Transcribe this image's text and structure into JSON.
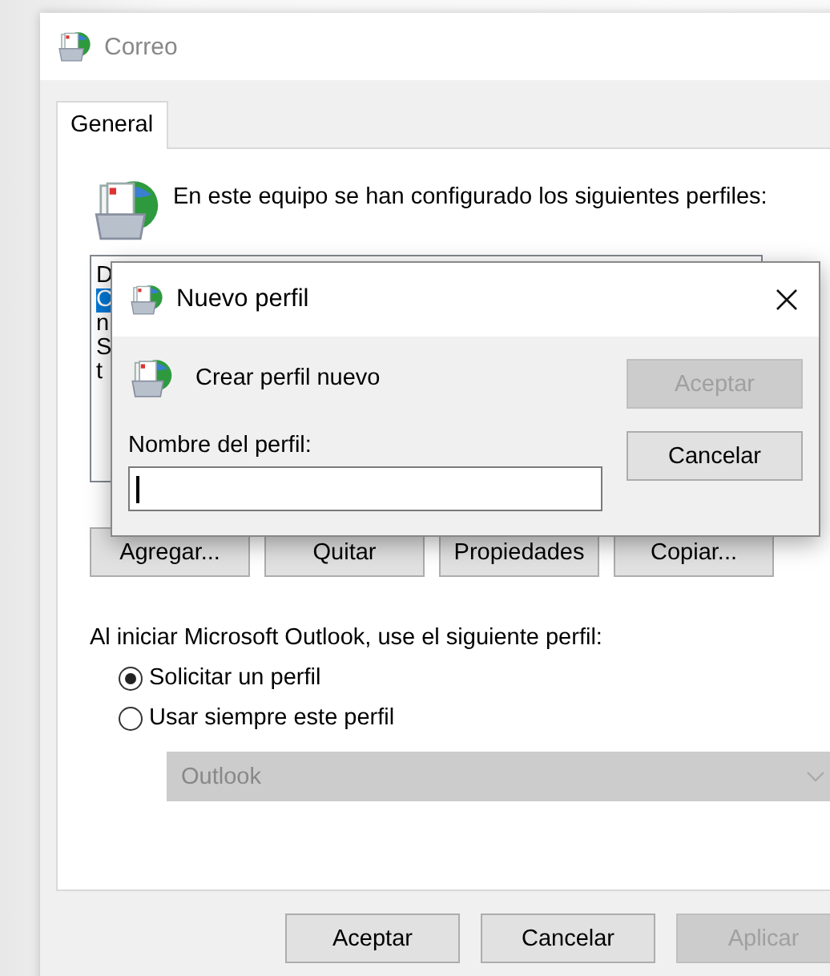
{
  "window": {
    "title": "Correo"
  },
  "tabs": [
    {
      "label": "General",
      "selected": true
    }
  ],
  "intro": "En este equipo se han configurado los siguientes perfiles:",
  "profiles": [
    {
      "label": "D",
      "selected": false
    },
    {
      "label": "C",
      "selected": true
    },
    {
      "label": "n",
      "selected": false
    },
    {
      "label": "S",
      "selected": false
    },
    {
      "label": "t",
      "selected": false
    }
  ],
  "profile_buttons": [
    "Agregar...",
    "Quitar",
    "Propiedades",
    "Copiar..."
  ],
  "startup_label": "Al iniciar Microsoft Outlook, use el siguiente perfil:",
  "startup_options": [
    {
      "label": "Solicitar un perfil",
      "selected": true
    },
    {
      "label": "Usar siempre este perfil",
      "selected": false
    }
  ],
  "profile_combo": {
    "value": "Outlook",
    "disabled": true
  },
  "buttons": [
    {
      "label": "Aceptar",
      "disabled": false
    },
    {
      "label": "Cancelar",
      "disabled": false
    },
    {
      "label": "Aplicar",
      "disabled": true
    }
  ],
  "dialog": {
    "title": "Nuevo perfil",
    "heading": "Crear perfil nuevo",
    "field_label": "Nombre del perfil:",
    "buttons": [
      {
        "label": "Aceptar",
        "disabled": true
      },
      {
        "label": "Cancelar",
        "disabled": false
      }
    ]
  }
}
